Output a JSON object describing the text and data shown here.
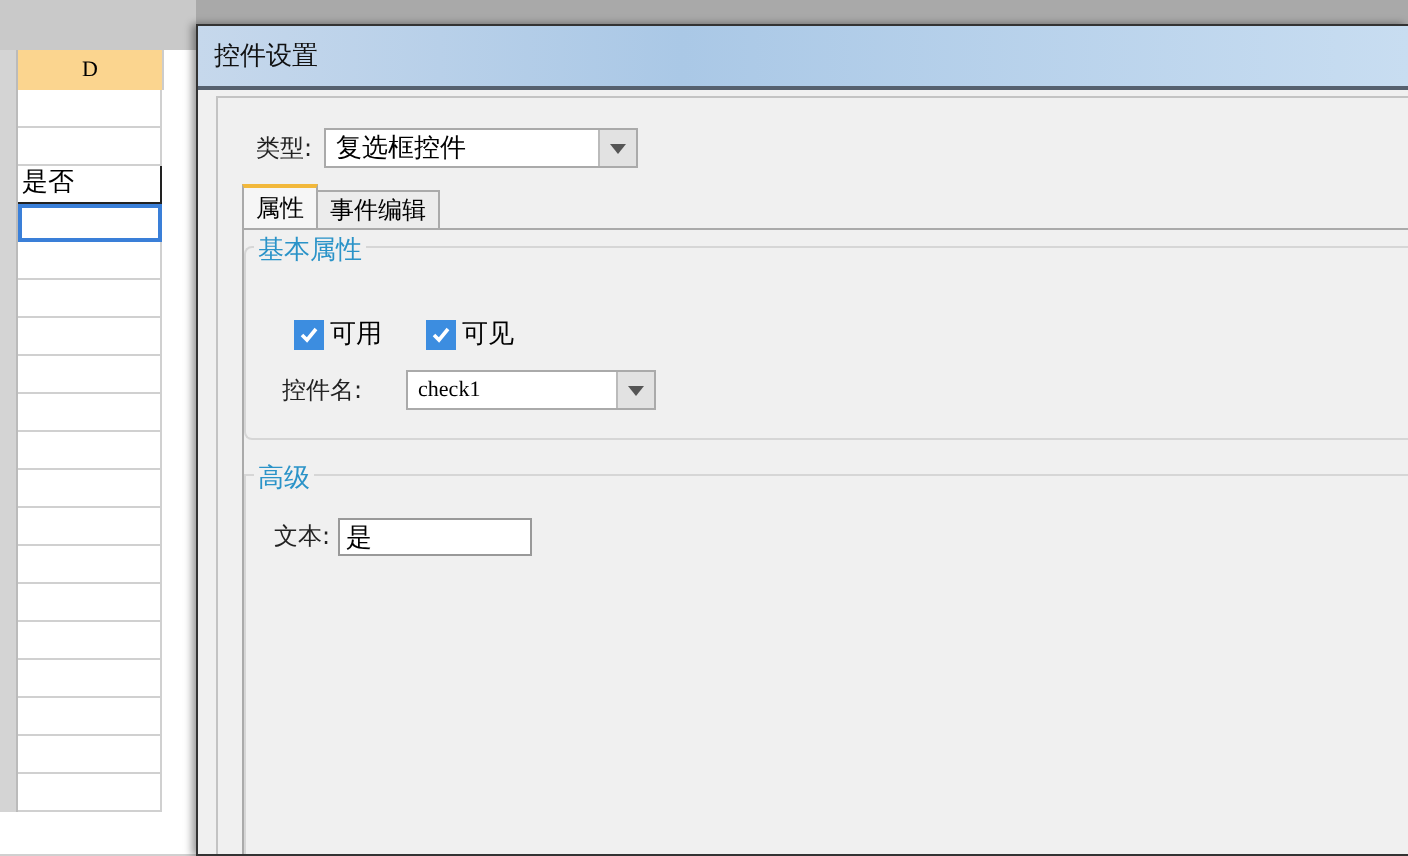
{
  "sheet": {
    "column_header": "D",
    "cells": [
      {
        "text": ""
      },
      {
        "text": ""
      },
      {
        "text": "是否",
        "bordered": true,
        "selected": false
      },
      {
        "text": "",
        "bordered": true,
        "selected": true
      },
      {
        "text": ""
      },
      {
        "text": ""
      },
      {
        "text": ""
      },
      {
        "text": ""
      },
      {
        "text": ""
      },
      {
        "text": ""
      },
      {
        "text": ""
      },
      {
        "text": ""
      },
      {
        "text": ""
      },
      {
        "text": ""
      },
      {
        "text": ""
      },
      {
        "text": ""
      },
      {
        "text": ""
      },
      {
        "text": ""
      },
      {
        "text": ""
      }
    ]
  },
  "dialog": {
    "title": "控件设置",
    "type_label": "类型:",
    "type_value": "复选框控件",
    "tabs": [
      {
        "label": "属性",
        "selected": true
      },
      {
        "label": "事件编辑",
        "selected": false
      }
    ],
    "basic_group": {
      "title": "基本属性",
      "checkboxes": [
        {
          "label": "可用",
          "checked": true
        },
        {
          "label": "可见",
          "checked": true
        }
      ],
      "name_label": "控件名:",
      "name_value": "check1"
    },
    "advanced_group": {
      "title": "高级",
      "text_label": "文本:",
      "text_value": "是"
    }
  }
}
